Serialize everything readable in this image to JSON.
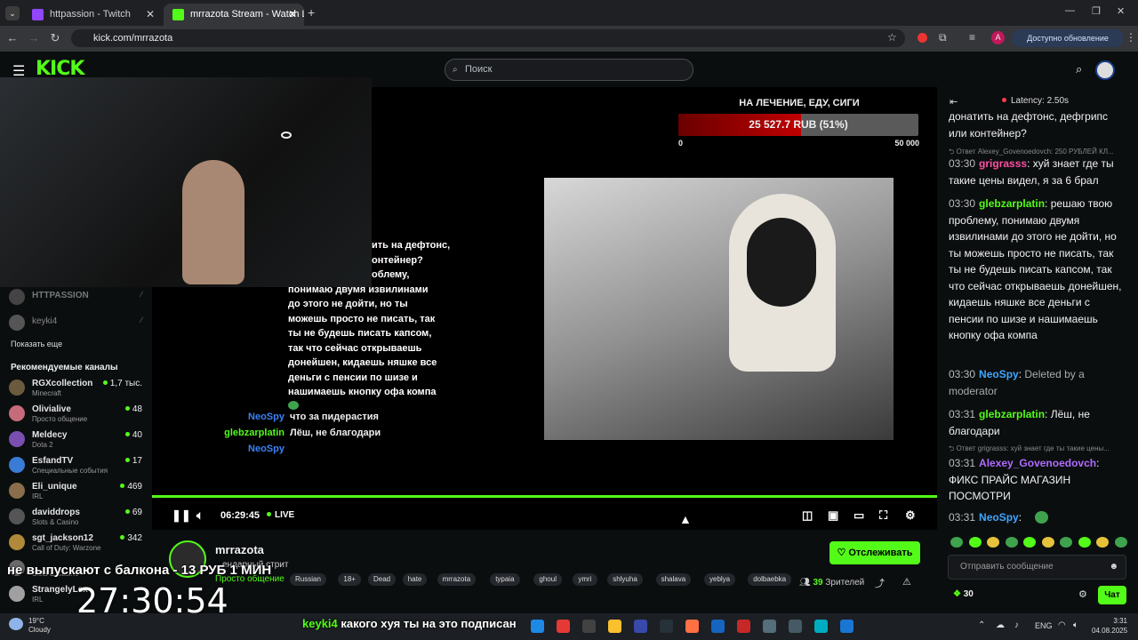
{
  "browser": {
    "tabs": [
      {
        "title": "httpassion - Twitch",
        "active": false
      },
      {
        "title": "mrrazota Stream - Watch Li",
        "active": true
      }
    ],
    "url": "kick.com/mrrazota",
    "update_label": "Доступно обновление Chrome",
    "profile_letter": "A"
  },
  "kick": {
    "logo": "KICK",
    "search_placeholder": "Поиск"
  },
  "sidebar": {
    "followed": [
      {
        "name": "HTTPASSION"
      },
      {
        "name": "keyki4"
      }
    ],
    "show_more": "Показать еще",
    "recommended_title": "Рекомендуемые каналы",
    "recommended": [
      {
        "name": "RGXcollection",
        "category": "Minecraft",
        "viewers": "1,7 тыс."
      },
      {
        "name": "Olivialive",
        "category": "Просто общение",
        "viewers": "48"
      },
      {
        "name": "Meldecy",
        "category": "Dota 2",
        "viewers": "40"
      },
      {
        "name": "EsfandTV",
        "category": "Специальные события",
        "viewers": "17"
      },
      {
        "name": "Eli_unique",
        "category": "IRL",
        "viewers": "469"
      },
      {
        "name": "daviddrops",
        "category": "Slots & Casino",
        "viewers": "69"
      },
      {
        "name": "sgt_jackson12",
        "category": "Call of Duty: Warzone",
        "viewers": "342"
      },
      {
        "name": "",
        "category": "Slots & Casino",
        "viewers": ""
      },
      {
        "name": "StrangelyLex",
        "category": "IRL",
        "viewers": ""
      }
    ]
  },
  "player": {
    "goal": {
      "title": "НА ЛЕЧЕНИЕ, ЕДУ, СИГИ",
      "text": "25 527.7 RUB (51%)",
      "progress": 0.51,
      "min": "0",
      "max": "50 000"
    },
    "overlay_chat_text": [
      "ить на дефтонс,",
      "онтейнер?",
      "облему,",
      "понимаю двумя извилинами",
      "до этого не дойти, но ты",
      "можешь просто не писать, так",
      "ты не будешь писать капсом,",
      "так что сейчас открываешь",
      "донейшен, кидаешь няшке все",
      "деньги с пенсии по шизе и",
      "нашимаешь кнопку офа компа"
    ],
    "overlay_msgs": [
      {
        "user": "NeoSpy",
        "text": "что за пидерастия",
        "color": "#3b82f6"
      },
      {
        "user": "glebzarplatin",
        "text": "Лёш, не благодари",
        "color": "#53fc18"
      },
      {
        "user": "NeoSpy",
        "text": "",
        "color": "#3b82f6"
      }
    ],
    "time": "06:29:45",
    "live_label": "LIVE"
  },
  "channel": {
    "name": "mrrazota",
    "subtitle": "ендарный стрит",
    "category": "Просто общение",
    "tags": [
      "Russian",
      "18+",
      "Dead",
      "hate",
      "mrrazota",
      "typaia",
      "ghoul",
      "ymri",
      "shlyuha",
      "shalava",
      "yeblya",
      "dolbaebka"
    ],
    "follow_label": "Отслеживать",
    "viewers": "39",
    "viewers_label": "Зрителей"
  },
  "chat": {
    "latency": "Latency: 2.50s",
    "messages": [
      {
        "time": "",
        "user": "",
        "user_color": "#fff",
        "text": "донатить на дефтонс, дефгрипс или контейнер?"
      },
      {
        "reply": "Ответ Alexey_Govenoedovch: 250 РУБЛЕЙ КЛ..."
      },
      {
        "time": "03:30",
        "user": "grigrasss",
        "user_color": "#ff4fa3",
        "text": "хуй знает где ты такие цены видел, я за 6 брал"
      },
      {
        "time": "03:30",
        "user": "glebzarplatin",
        "user_color": "#53fc18",
        "text": "решаю твою проблему, понимаю двумя извилинами до этого не дойти, но ты можешь просто не писать, так ты не будешь писать капсом, так что сейчас открываешь донейшен, кидаешь няшке все деньги с пенсии по шизе и нашимаешь кнопку офа компа"
      },
      {
        "time": "03:30",
        "user": "NeoSpy",
        "user_color": "#3ea6ff",
        "text": "Deleted by a moderator"
      },
      {
        "time": "03:31",
        "user": "glebzarplatin",
        "user_color": "#53fc18",
        "text": "Лёш, не благодари"
      },
      {
        "reply": "Ответ grigrasss: хуй знает где ты такие цены..."
      },
      {
        "time": "03:31",
        "user": "Alexey_Govenoedovch",
        "user_color": "#b06bff",
        "text": "ФИКС ПРАЙС МАГАЗИН ПОСМОТРИ"
      },
      {
        "time": "03:31",
        "user": "NeoSpy",
        "user_color": "#3ea6ff",
        "text": ""
      }
    ],
    "input_placeholder": "Отправить сообщение",
    "points": "30",
    "send_label": "Чат"
  },
  "overlays": {
    "banner": "не выпускают с балкона - 13 РУБ 1 МИН",
    "timer": "27:30:54",
    "bottom_user": "keyki4",
    "bottom_text": "какого хуя ты на это подписан"
  },
  "taskbar": {
    "weather_temp": "19°C",
    "weather_desc": "Cloudy",
    "lang": "ENG",
    "time": "3:31",
    "date": "04.08.2025"
  }
}
